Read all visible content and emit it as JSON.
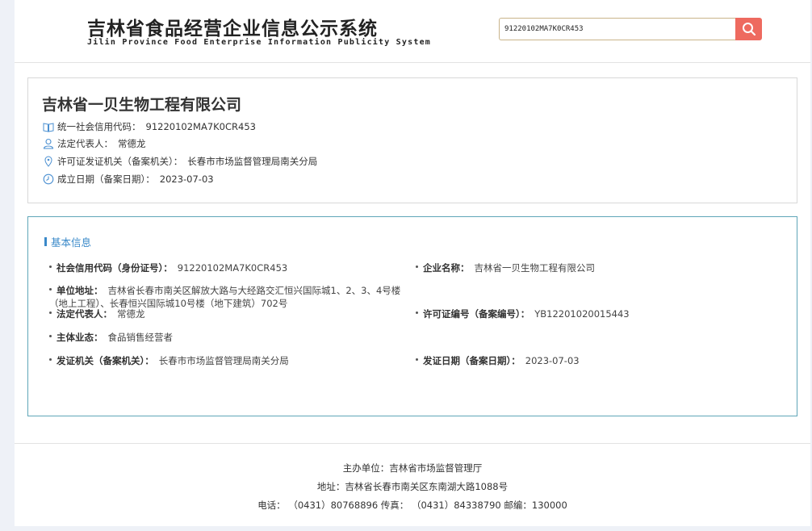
{
  "header": {
    "title": "吉林省食品经营企业信息公示系统",
    "subtitle": "Jilin Province Food Enterprise Information Publicity System",
    "search": {
      "value": "91220102MA7K0CR453",
      "icon": "search-icon",
      "button_color": "#ee6a5f"
    }
  },
  "company": {
    "name": "吉林省一贝生物工程有限公司",
    "lines": [
      {
        "icon": "book-icon",
        "label": "统一社会信用代码：",
        "value": "91220102MA7K0CR453"
      },
      {
        "icon": "person-icon",
        "label": "法定代表人：",
        "value": "常德龙"
      },
      {
        "icon": "location-pin-icon",
        "label": "许可证发证机关（备案机关）：",
        "value": "长春市市场监督管理局南关分局"
      },
      {
        "icon": "clock-icon",
        "label": "成立日期（备案日期）：",
        "value": "2023-07-03"
      }
    ]
  },
  "basic_info": {
    "title": "基本信息",
    "accent_color": "#3a89c9",
    "fields": {
      "credit_code": {
        "label": "社会信用代码（身份证号）：",
        "value": "91220102MA7K0CR453"
      },
      "company_name": {
        "label": "企业名称：",
        "value": "吉林省一贝生物工程有限公司"
      },
      "address": {
        "label": "单位地址：",
        "value": "吉林省长春市南关区解放大路与大经路交汇恒兴国际城1、2、3、4号楼（地上工程）、长春恒兴国际城10号楼（地下建筑）702号"
      },
      "legal_rep": {
        "label": "法定代表人：",
        "value": "常德龙"
      },
      "license_no": {
        "label": "许可证编号（备案编号）：",
        "value": "YB12201020015443"
      },
      "business_type": {
        "label": "主体业态：",
        "value": "食品销售经营者"
      },
      "issuer": {
        "label": "发证机关（备案机关）：",
        "value": "长春市市场监督管理局南关分局"
      },
      "issue_date": {
        "label": "发证日期（备案日期）：",
        "value": "2023-07-03"
      }
    }
  },
  "footer": {
    "sponsor": "主办单位：吉林省市场监督管理厅",
    "address": "地址：吉林省长春市南关区东南湖大路1088号",
    "contact": "电话： （0431）80768896 传真： （0431）84338790 邮编：130000"
  }
}
